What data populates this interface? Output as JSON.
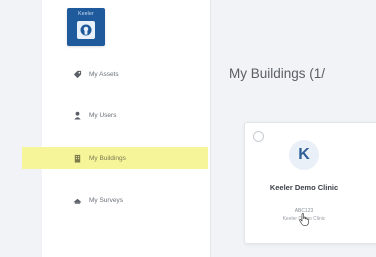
{
  "app": {
    "logo_text": "Keeler"
  },
  "sidebar": {
    "items": [
      {
        "label": "My Assets",
        "icon": "tag-icon"
      },
      {
        "label": "My Users",
        "icon": "user-icon"
      },
      {
        "label": "My Buildings",
        "icon": "building-icon",
        "active": true
      },
      {
        "label": "My Surveys",
        "icon": "survey-icon"
      }
    ]
  },
  "main": {
    "title": "My Buildings (1/"
  },
  "cards": [
    {
      "avatar_letter": "K",
      "name": "Keeler Demo Clinic",
      "code": "ABC123",
      "subtitle": "Keeler Demo Clinic"
    }
  ],
  "colors": {
    "active_highlight": "#f7f59a",
    "brand": "#1f5b9c",
    "avatar_text": "#2e5f97"
  }
}
